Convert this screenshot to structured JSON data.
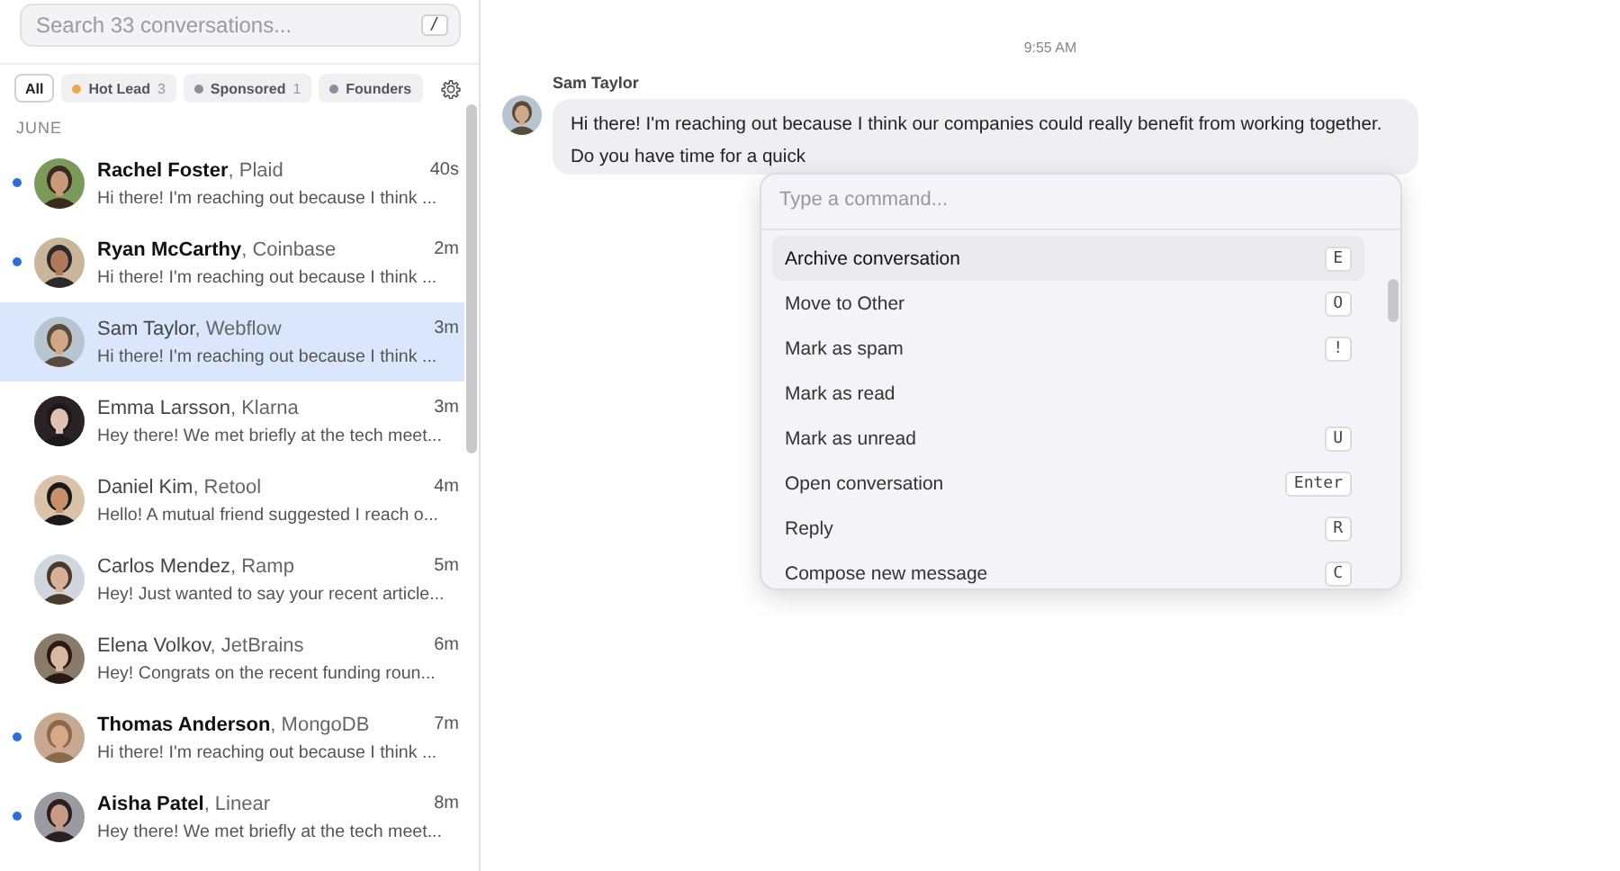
{
  "sidebar": {
    "search": {
      "placeholder": "Search 33 conversations...",
      "shortcut": "/"
    },
    "filters": [
      {
        "label": "All",
        "selected": true
      },
      {
        "label": "Hot Lead",
        "count": "3",
        "color": "#f0a94a",
        "selected": false
      },
      {
        "label": "Sponsored",
        "count": "1",
        "color": "#8a8f9c",
        "selected": false
      },
      {
        "label": "Founders",
        "color": "#8a8f9c",
        "selected": false
      }
    ],
    "section": "JUNE",
    "conversations": [
      {
        "name": "Rachel Foster",
        "company": ", Plaid",
        "time": "40s",
        "preview": "Hi there! I'm reaching out because I think ...",
        "unread": true,
        "selected": false
      },
      {
        "name": "Ryan McCarthy",
        "company": ", Coinbase",
        "time": "2m",
        "preview": "Hi there! I'm reaching out because I think ...",
        "unread": true,
        "selected": false
      },
      {
        "name": "Sam Taylor",
        "company": ", Webflow",
        "time": "3m",
        "preview": "Hi there! I'm reaching out because I think ...",
        "unread": false,
        "selected": true
      },
      {
        "name": "Emma Larsson",
        "company": ", Klarna",
        "time": "3m",
        "preview": "Hey there! We met briefly at the tech meet...",
        "unread": false,
        "selected": false
      },
      {
        "name": "Daniel Kim",
        "company": ", Retool",
        "time": "4m",
        "preview": "Hello! A mutual friend suggested I reach o...",
        "unread": false,
        "selected": false
      },
      {
        "name": "Carlos Mendez",
        "company": ", Ramp",
        "time": "5m",
        "preview": "Hey! Just wanted to say your recent article...",
        "unread": false,
        "selected": false
      },
      {
        "name": "Elena Volkov",
        "company": ", JetBrains",
        "time": "6m",
        "preview": "Hey! Congrats on the recent funding roun...",
        "unread": false,
        "selected": false
      },
      {
        "name": "Thomas Anderson",
        "company": ", MongoDB",
        "time": "7m",
        "preview": "Hi there! I'm reaching out because I think ...",
        "unread": true,
        "selected": false
      },
      {
        "name": "Aisha Patel",
        "company": ", Linear",
        "time": "8m",
        "preview": "Hey there! We met briefly at the tech meet...",
        "unread": true,
        "selected": false
      }
    ]
  },
  "chat": {
    "timestamp": "9:55 AM",
    "messages": [
      {
        "sender": "Sam Taylor",
        "text": "Hi there! I'm reaching out because I think our companies could really benefit from working together. Do you have time for a quick"
      }
    ]
  },
  "command_palette": {
    "placeholder": "Type a command...",
    "commands": [
      {
        "label": "Archive conversation",
        "shortcut": "E",
        "selected": true
      },
      {
        "label": "Move to Other",
        "shortcut": "O",
        "selected": false
      },
      {
        "label": "Mark as spam",
        "shortcut": "!",
        "selected": false
      },
      {
        "label": "Mark as read",
        "selected": false
      },
      {
        "label": "Mark as unread",
        "shortcut": "U",
        "selected": false
      },
      {
        "label": "Open conversation",
        "shortcut": "Enter",
        "selected": false
      },
      {
        "label": "Reply",
        "shortcut": "R",
        "selected": false
      },
      {
        "label": "Compose new message",
        "shortcut": "C",
        "selected": false
      }
    ]
  }
}
